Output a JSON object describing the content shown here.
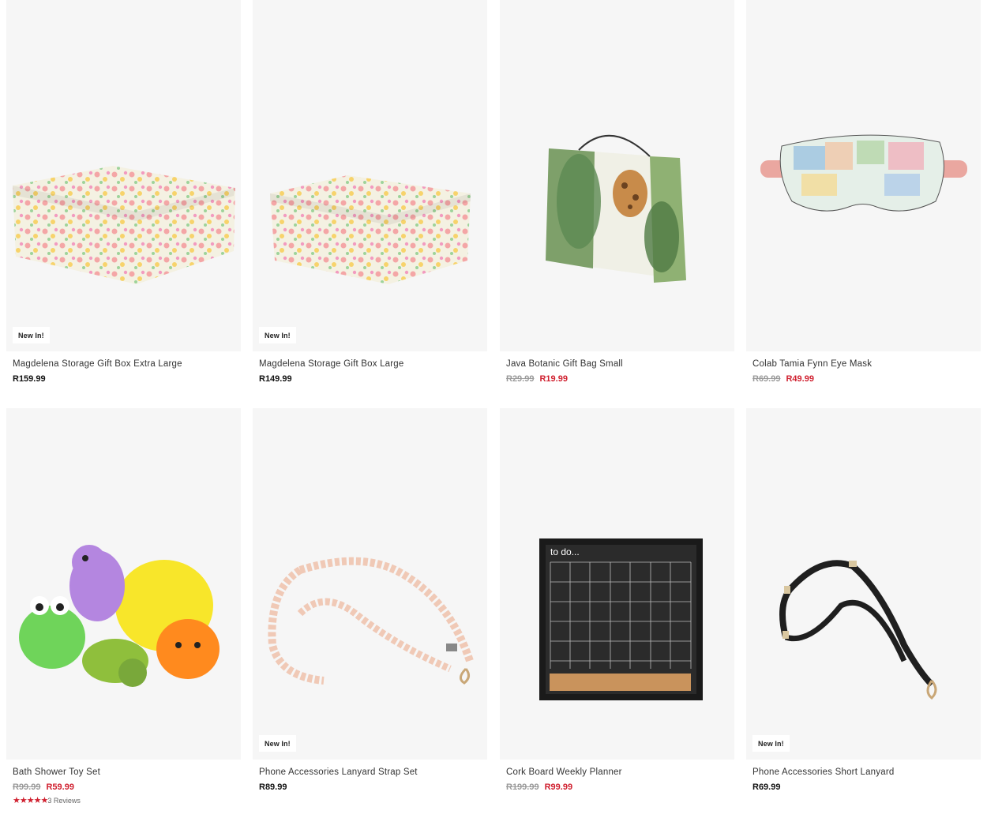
{
  "products": [
    {
      "name": "Magdelena Storage Gift Box Extra Large",
      "badge": "New In!",
      "price": "R159.99",
      "old_price": "",
      "sale_price": ""
    },
    {
      "name": "Magdelena Storage Gift Box Large",
      "badge": "New In!",
      "price": "R149.99",
      "old_price": "",
      "sale_price": ""
    },
    {
      "name": "Java Botanic Gift Bag Small",
      "badge": "",
      "price": "",
      "old_price": "R29.99",
      "sale_price": "R19.99"
    },
    {
      "name": "Colab Tamia Fynn Eye Mask",
      "badge": "",
      "price": "",
      "old_price": "R69.99",
      "sale_price": "R49.99"
    },
    {
      "name": "Bath Shower Toy Set",
      "badge": "",
      "price": "",
      "old_price": "R99.99",
      "sale_price": "R59.99",
      "stars": "★★★★★",
      "rating": 5,
      "reviews": "3 Reviews"
    },
    {
      "name": "Phone Accessories Lanyard Strap Set",
      "badge": "New In!",
      "price": "R89.99",
      "old_price": "",
      "sale_price": ""
    },
    {
      "name": "Cork Board Weekly Planner",
      "badge": "",
      "price": "",
      "old_price": "R199.99",
      "sale_price": "R99.99",
      "planner_heading": "to do..."
    },
    {
      "name": "Phone Accessories Short Lanyard",
      "badge": "New In!",
      "price": "R69.99",
      "old_price": "",
      "sale_price": ""
    }
  ],
  "colors": {
    "sale": "#d0202f",
    "old": "#9a9a9a",
    "tile_bg": "#f6f6f6"
  }
}
